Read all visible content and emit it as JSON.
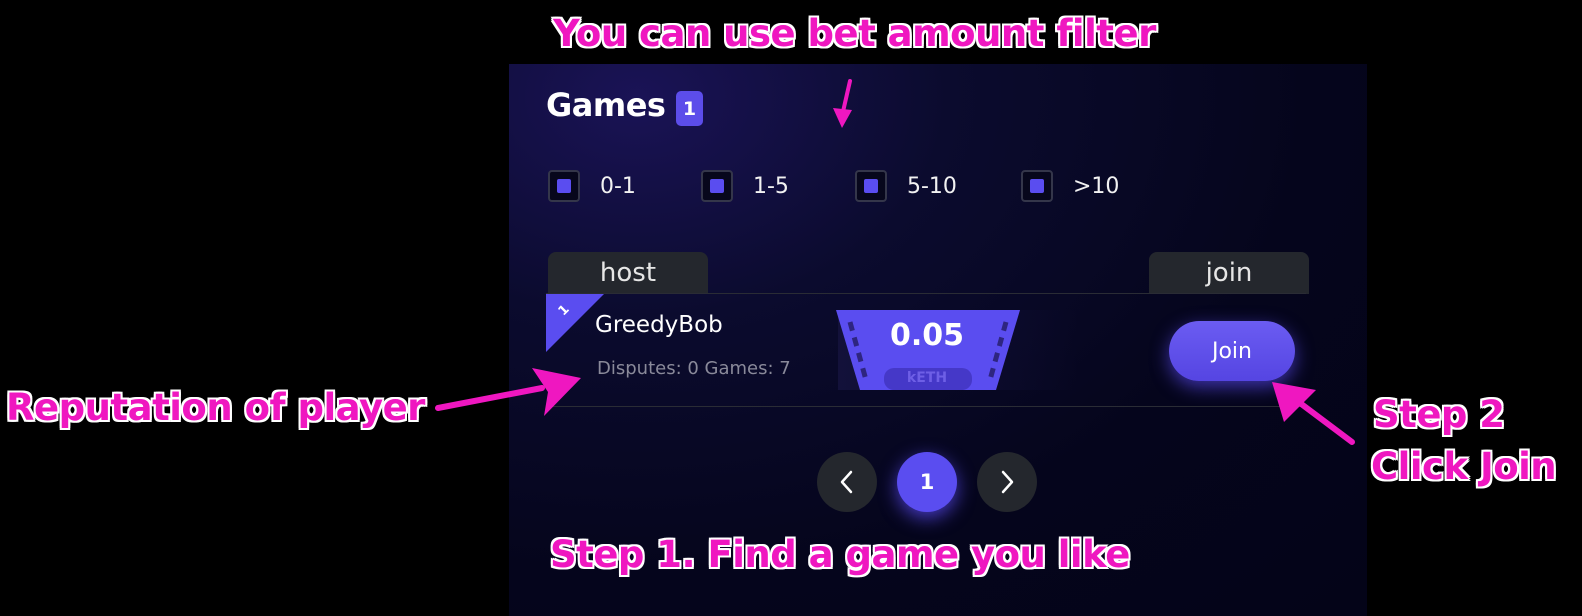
{
  "games": {
    "title": "Games",
    "count": "1",
    "filters": [
      {
        "label": "0-1"
      },
      {
        "label": "1-5"
      },
      {
        "label": "5-10"
      },
      {
        "label": ">10"
      }
    ],
    "columns": {
      "host": "host",
      "join": "join"
    },
    "rows": [
      {
        "rank": "1",
        "host": "GreedyBob",
        "reputation": "Disputes: 0 Games: 7",
        "bet_amount": "0.05",
        "bet_unit": "kETH",
        "join_label": "Join"
      }
    ],
    "pagination": {
      "current": "1",
      "prev_icon": "chevron-left-icon",
      "next_icon": "chevron-right-icon"
    }
  },
  "annotations": {
    "filter_hint": "You can use bet amount filter",
    "reputation": "Reputation of player",
    "step2_line1": "Step 2",
    "step2_line2": "Click  Join",
    "step1": "Step 1. Find a game you like"
  },
  "colors": {
    "accent": "#5a4df0",
    "annotation": "#ef17c0",
    "panel_bg": "#05051c"
  }
}
